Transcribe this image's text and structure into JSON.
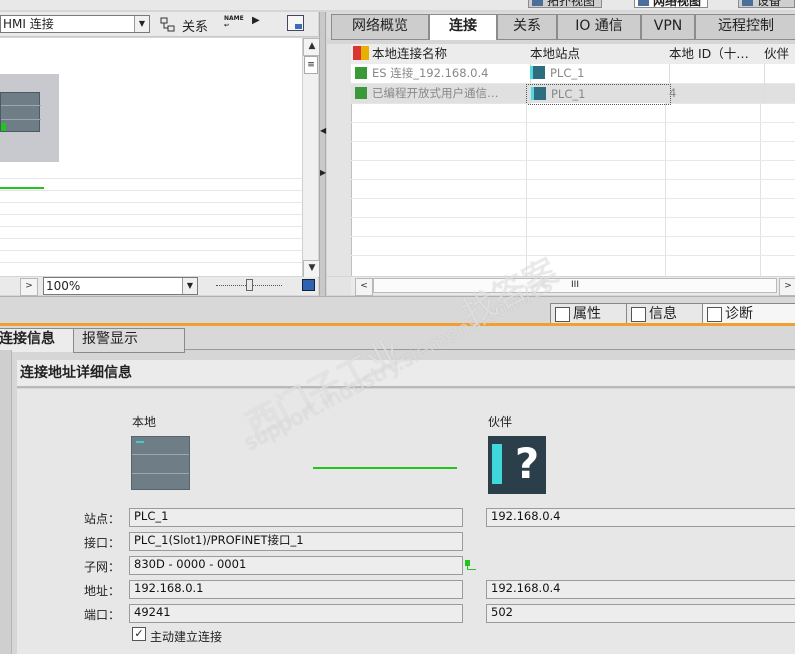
{
  "top_tabs": [
    "拓扑视图",
    "网络视图",
    "设备视图"
  ],
  "left_toolbar": {
    "connection_type": "HMI 连接",
    "relations_label": "关系",
    "zoom": "100%"
  },
  "right_tabs": [
    "网络概览",
    "连接",
    "关系",
    "IO 通信",
    "VPN",
    "远程控制"
  ],
  "grid": {
    "columns": [
      "本地连接名称",
      "本地站点",
      "本地 ID（十…",
      "伙伴"
    ],
    "rows": [
      {
        "name": "ES 连接_192.168.0.4",
        "station": "PLC_1",
        "id": ""
      },
      {
        "name": "已编程开放式用户通信…",
        "station": "PLC_1",
        "id": "4"
      }
    ],
    "scroll_label": "III"
  },
  "inspector_tabs": [
    "属性",
    "信息",
    "诊断"
  ],
  "sub_tabs": [
    "连接信息",
    "报警显示"
  ],
  "section_title": "连接地址详细信息",
  "local_label": "本地",
  "partner_label": "伙伴",
  "fields": {
    "labels": [
      "站点：",
      "接口：",
      "子网：",
      "地址：",
      "端口："
    ],
    "local": [
      "PLC_1",
      "PLC_1(Slot1)/PROFINET接口_1",
      "830D - 0000 - 0001",
      "192.168.0.1",
      "49241"
    ],
    "partner": [
      "192.168.0.4",
      "",
      "",
      "192.168.0.4",
      "502"
    ]
  },
  "active_connect": {
    "label": "主动建立连接",
    "checked": true
  },
  "watermark": {
    "line1": "西门子工业",
    "line2": "support.industry.siemens.com/cs",
    "line3": "找答案"
  },
  "colors": {
    "accent": "#f0a030",
    "link_green": "#22c322",
    "plc_gray": "#6f7d86"
  }
}
